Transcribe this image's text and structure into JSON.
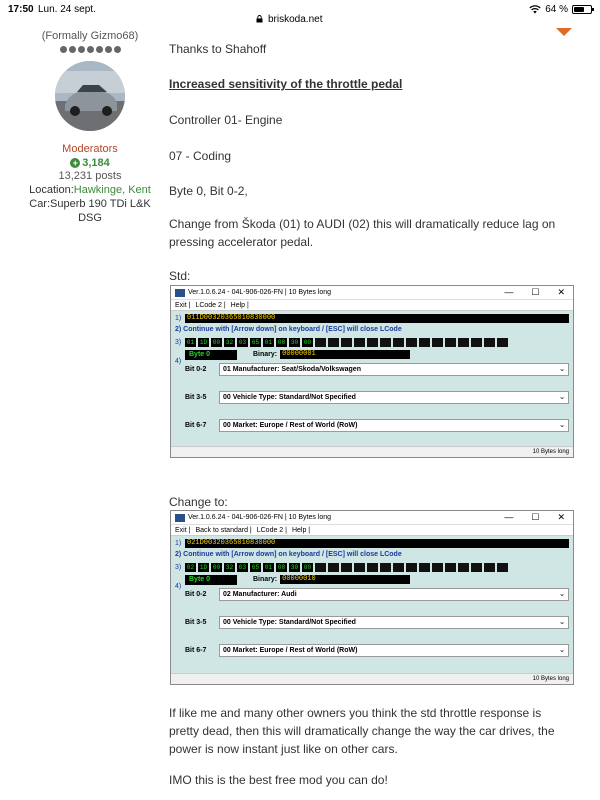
{
  "status_bar": {
    "time": "17:50",
    "date": "Lun. 24 sept.",
    "url": "briskoda.net",
    "battery_pct": "64 %",
    "battery_level": 0.64
  },
  "sidebar": {
    "formerly": "(Formally Gizmo68)",
    "rank_dots": 7,
    "role": "Moderators",
    "reputation": "3,184",
    "posts": "13,231 posts",
    "location_label": "Location:",
    "location_value": "Hawkinge, Kent",
    "car": "Car:Superb 190 TDi L&K DSG"
  },
  "post": {
    "thanks": "Thanks to Shahoff",
    "title": "Increased sensitivity of the throttle pedal",
    "controller": "Controller 01- Engine",
    "coding": "07 - Coding",
    "byte": "Byte 0, Bit 0-2,",
    "change_desc": "Change from Škoda (01) to AUDI (02) this will dramatically reduce lag on pressing accelerator pedal.",
    "std_label": "Std:",
    "change_label": "Change to:",
    "para1": "If like me and many other owners you think the std throttle response is pretty dead, then this will dramatically change the way the car drives, the power is now instant just like on other cars.",
    "para2": "IMO this is the best free mod you can do!"
  },
  "screens": [
    {
      "title": "Ver.1.0.6.24 -   04L-906-026-FN | 10 Bytes long",
      "menu": [
        "Exit |",
        "LCode 2 |",
        "Help |"
      ],
      "row1_num": "1)",
      "row1_value": "011D00320365010830000",
      "row2": "2) Continue with [Arrow down] on keyboard / [ESC] will close LCode",
      "row3_num": "3)",
      "bytes": [
        "01",
        "1D",
        "00",
        "32",
        "03",
        "65",
        "01",
        "08",
        "30",
        "00"
      ],
      "byte_label": "Byte 0",
      "binary_label": "Binary:",
      "binary_value": "00000001",
      "row4_num": "4)",
      "bits": [
        {
          "label": "Bit 0-2",
          "value": "01 Manufacturer: Seat/Skoda/Volkswagen"
        },
        {
          "label": "Bit 3-5",
          "value": "00 Vehicle Type: Standard/Not Specified"
        },
        {
          "label": "Bit 6-7",
          "value": "00 Market: Europe / Rest of World (RoW)"
        }
      ],
      "footer": "10 Bytes long"
    },
    {
      "title": "Ver.1.0.6.24 -   04L-906-026-FN | 10 Bytes long",
      "menu": [
        "Exit |",
        "Back to standard |",
        "LCode 2 |",
        "Help |"
      ],
      "row1_num": "1)",
      "row1_value": "021D00320365010830000",
      "row2": "2) Continue with [Arrow down] on keyboard / [ESC] will close LCode",
      "row3_num": "3)",
      "bytes": [
        "02",
        "1D",
        "00",
        "32",
        "03",
        "65",
        "01",
        "08",
        "30",
        "00"
      ],
      "byte_label": "Byte 0",
      "binary_label": "Binary:",
      "binary_value": "00000010",
      "row4_num": "4)",
      "bits": [
        {
          "label": "Bit 0-2",
          "value": "02 Manufacturer: Audi"
        },
        {
          "label": "Bit 3-5",
          "value": "00 Vehicle Type: Standard/Not Specified"
        },
        {
          "label": "Bit 6-7",
          "value": "00 Market: Europe / Rest of World (RoW)"
        }
      ],
      "footer": "10 Bytes long"
    }
  ],
  "colors": {
    "accent_orange": "#e06a2a",
    "moderator_red": "#b5462b",
    "green": "#3d8a3d",
    "lcode_bg": "#cfe6e5"
  }
}
